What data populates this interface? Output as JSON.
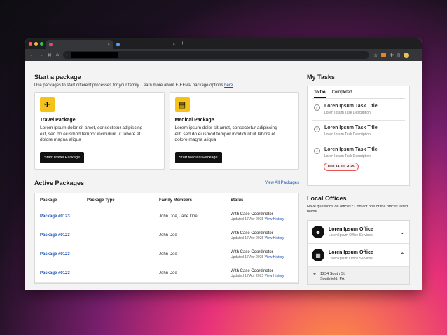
{
  "browser": {
    "tabs": [
      {
        "close": "×"
      },
      {
        "close": "×"
      }
    ],
    "new_tab": "+"
  },
  "start": {
    "title": "Start a package",
    "subtitle": "Use packages to start different processes for your family. Learn more about E-EFMP package options ",
    "subtitle_link": "here",
    "subtitle_end": "."
  },
  "cards": [
    {
      "title": "Travel Package",
      "text": "Lorem ipsum dolor sit amet, consectetur adipiscing elit, sed do eiusmod tempor incididunt ut labore et dolore magna aliqua",
      "button": "Start Travel Package",
      "icon": "airplane-icon"
    },
    {
      "title": "Medical Package",
      "text": "Lorem ipsum dolor sit amet, consectetur adipiscing elit, sed do eiusmod tempor incididunt ut labore et dolore magna aliqua",
      "button": "Start Medical Package",
      "icon": "medicine-bottle-icon"
    }
  ],
  "active": {
    "title": "Active Packages",
    "view_all": "View All Packages",
    "columns": [
      "Package",
      "Package Type",
      "Family Members",
      "Status"
    ],
    "rows": [
      {
        "package": "Package #0123",
        "type": "",
        "members": "John Doe, Jane Doe",
        "status": "With Case Coordinator",
        "updated": "Updated 17 Apr 2025",
        "history": "View History"
      },
      {
        "package": "Package #0123",
        "type": "",
        "members": "John Doe",
        "status": "With Case Coordinator",
        "updated": "Updated 17 Apr 2025",
        "history": "View History"
      },
      {
        "package": "Package #0123",
        "type": "",
        "members": "John Doe",
        "status": "With Case Coordinator",
        "updated": "Updated 17 Apr 2025",
        "history": "View History"
      },
      {
        "package": "Package #0123",
        "type": "",
        "members": "John Doe",
        "status": "With Case Coordinator",
        "updated": "Updated 17 Apr 2025",
        "history": "View History"
      }
    ]
  },
  "tasks": {
    "title": "My Tasks",
    "tab_todo": "To Do",
    "tab_completed": "Completed",
    "items": [
      {
        "title": "Loren Ipsum Task Title",
        "desc": "Loren Ipsum Task Description"
      },
      {
        "title": "Loren Ipsum Task Title",
        "desc": "Loren Ipsum Task Description"
      },
      {
        "title": "Loren Ipsum Task Title",
        "desc": "Loren Ipsum Task Description",
        "due": "Due 14 Jul 2025"
      }
    ]
  },
  "offices": {
    "title": "Local Offices",
    "subtitle": "Have questions on offices? Contact one of the offices listed below.",
    "items": [
      {
        "name": "Loren Ipsum Office",
        "services": "Loren Ipsum Office Services",
        "expanded": false
      },
      {
        "name": "Loren Ipsum Office",
        "services": "Loren Ipsum Office Services",
        "expanded": true
      }
    ],
    "address_line1": "1234 South St",
    "address_line2": "Southfield, PA"
  },
  "colors": {
    "accent_yellow": "#f5c21b",
    "link_blue": "#1a4fb0",
    "due_red": "#e05a5a"
  }
}
